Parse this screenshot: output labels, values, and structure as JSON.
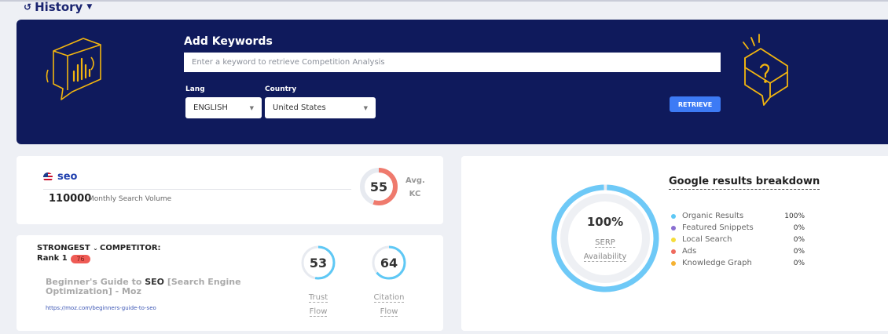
{
  "history": {
    "label": "History"
  },
  "banner": {
    "title": "Add Keywords",
    "keyword_placeholder": "Enter a keyword to retrieve Competition Analysis",
    "lang_label": "Lang",
    "lang_value": "ENGLISH",
    "country_label": "Country",
    "country_value": "United States",
    "retrieve_label": "RETRIEVE"
  },
  "keyword_card": {
    "keyword": "seo",
    "volume": "110000",
    "volume_label": "Monthly Search Volume",
    "kc_value": "55",
    "kc_fraction": 0.55,
    "avg_label_1": "Avg.",
    "avg_label_2": "KC"
  },
  "competitor_card": {
    "strongest_label": "STRONGEST",
    "competitor_label": "COMPETITOR:",
    "rank_label": "Rank 1",
    "rank_badge": "76",
    "title_prefix": "Beginner's Guide to ",
    "title_highlight": "SEO",
    "title_suffix": " [Search Engine Optimization] - Moz",
    "url": "https://moz.com/beginners-guide-to-seo",
    "trust_value": "53",
    "trust_fraction": 0.53,
    "trust_label_1": "Trust",
    "trust_label_2": "Flow",
    "citation_value": "64",
    "citation_fraction": 0.64,
    "citation_label_1": "Citation",
    "citation_label_2": "Flow"
  },
  "google_card": {
    "title": "Google results breakdown",
    "serp_pct": "100%",
    "serp_fraction": 1.0,
    "serp_label_1": "SERP",
    "serp_label_2": "Availability",
    "legend": [
      {
        "name": "Organic Results",
        "pct": "100%",
        "color": "#5ec8f5"
      },
      {
        "name": "Featured Snippets",
        "pct": "0%",
        "color": "#8a6fd1"
      },
      {
        "name": "Local Search",
        "pct": "0%",
        "color": "#f5dd3b"
      },
      {
        "name": "Ads",
        "pct": "0%",
        "color": "#ef6a5e"
      },
      {
        "name": "Knowledge Graph",
        "pct": "0%",
        "color": "#f5b233"
      }
    ]
  },
  "colors": {
    "banner": "#0f1a5c",
    "accent": "#3d7bf5",
    "kc": "#ef7a6d",
    "flow": "#5ec8f5",
    "serp": "#6ec9f7"
  }
}
